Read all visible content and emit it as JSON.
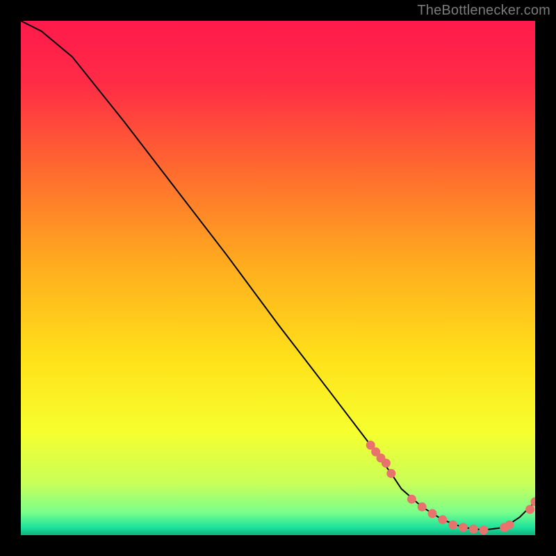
{
  "attribution": "TheBottlenecker.com",
  "chart_data": {
    "type": "line",
    "title": "",
    "xlabel": "",
    "ylabel": "",
    "xlim": [
      0,
      100
    ],
    "ylim": [
      0,
      100
    ],
    "x": [
      0,
      4,
      10,
      20,
      30,
      40,
      50,
      60,
      68,
      72,
      74,
      78,
      82,
      86,
      90,
      94,
      97,
      100
    ],
    "y": [
      100,
      98,
      93,
      80.5,
      67.5,
      54.5,
      41,
      28,
      17.5,
      12,
      9,
      5.5,
      3,
      1.5,
      1,
      1.5,
      3.5,
      6.5
    ],
    "markers": {
      "x": [
        68,
        69,
        70,
        71,
        72,
        76,
        78,
        80,
        82,
        84,
        86,
        88,
        90,
        94,
        95,
        99,
        100
      ],
      "y": [
        17.5,
        16.2,
        15,
        14,
        12,
        7,
        5.5,
        4.2,
        3,
        2,
        1.5,
        1.2,
        1,
        1.5,
        2,
        5,
        6.5
      ]
    },
    "colors": {
      "line": "#000000",
      "marker": "#e8736c",
      "gradient_stops": [
        {
          "offset": 0.0,
          "color": "#ff1a4b"
        },
        {
          "offset": 0.12,
          "color": "#ff2b46"
        },
        {
          "offset": 0.3,
          "color": "#ff6e2e"
        },
        {
          "offset": 0.48,
          "color": "#ffae1e"
        },
        {
          "offset": 0.66,
          "color": "#ffe21a"
        },
        {
          "offset": 0.8,
          "color": "#f6ff2e"
        },
        {
          "offset": 0.9,
          "color": "#c8ff5a"
        },
        {
          "offset": 0.955,
          "color": "#7cff8a"
        },
        {
          "offset": 0.985,
          "color": "#1de39d"
        },
        {
          "offset": 1.0,
          "color": "#0fb37e"
        }
      ]
    }
  }
}
